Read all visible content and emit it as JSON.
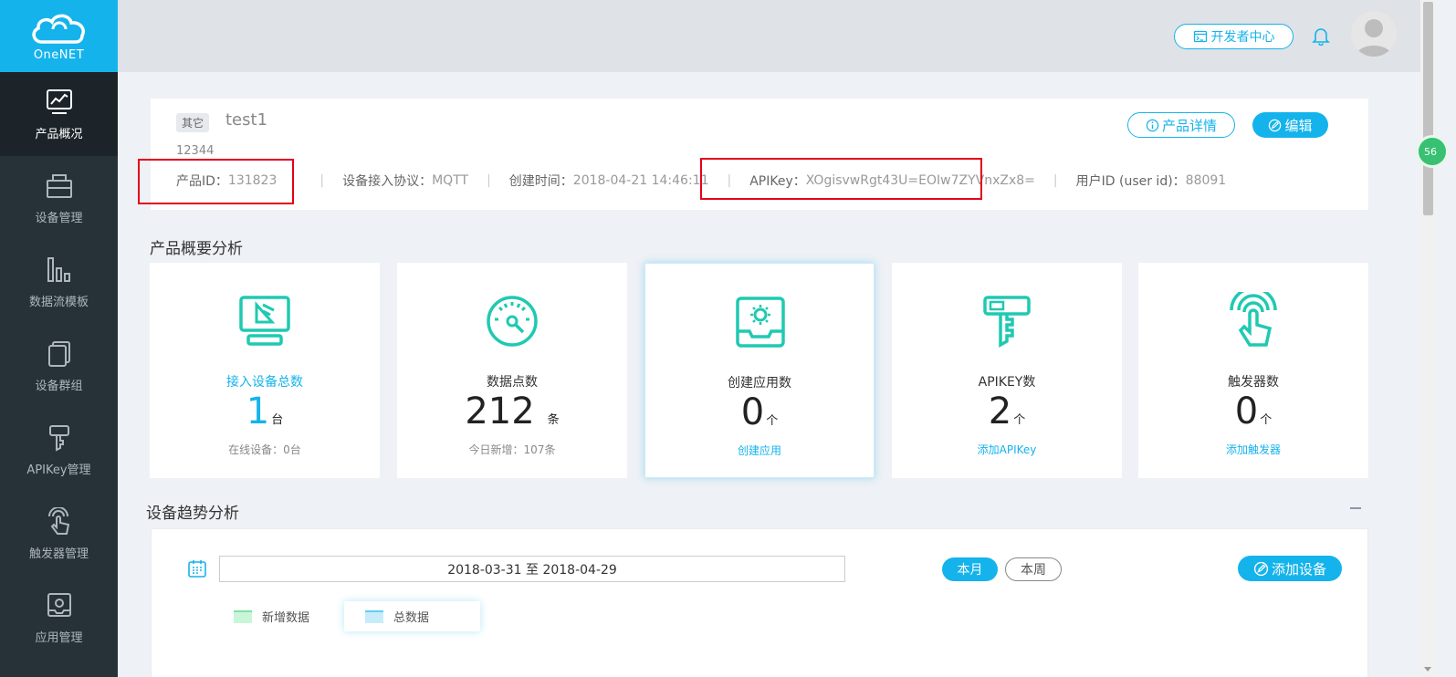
{
  "logo": {
    "text": "OneNET"
  },
  "sidebar": {
    "items": [
      {
        "label": "产品概况",
        "icon": "chart-monitor-icon",
        "active": true
      },
      {
        "label": "设备管理",
        "icon": "device-box-icon"
      },
      {
        "label": "数据流模板",
        "icon": "bar-chart-icon"
      },
      {
        "label": "设备群组",
        "icon": "device-group-icon"
      },
      {
        "label": "APIKey管理",
        "icon": "key-icon"
      },
      {
        "label": "触发器管理",
        "icon": "touch-hand-icon"
      },
      {
        "label": "应用管理",
        "icon": "app-gear-icon"
      }
    ]
  },
  "topbar": {
    "dev_center_label": "开发者中心",
    "icons": [
      "terminal-icon",
      "bell-icon",
      "avatar-icon"
    ]
  },
  "float_badge": "56",
  "product": {
    "tag": "其它",
    "name": "test1",
    "desc": "12344",
    "id_label": "产品ID：",
    "id_value": "131823",
    "protocol_label": "设备接入协议：",
    "protocol_value": "MQTT",
    "created_label": "创建时间：",
    "created_value": "2018-04-21 14:46:11",
    "apikey_label": "APIKey：",
    "apikey_value": "XOgisvwRgt43U=EOIw7ZYVnxZx8=",
    "userid_label": "用户ID (user id)：",
    "userid_value": "88091",
    "detail_btn": "产品详情",
    "edit_btn": "编辑",
    "sep": "|"
  },
  "overview": {
    "title": "产品概要分析",
    "cards": [
      {
        "label": "接入设备总数",
        "value": "1",
        "unit": "台",
        "sub": "在线设备：0台",
        "icon": "device-access-icon"
      },
      {
        "label": "数据点数",
        "value": "212",
        "unit": "条",
        "sub": "今日新增：107条",
        "icon": "gauge-icon"
      },
      {
        "label": "创建应用数",
        "value": "0",
        "unit": "个",
        "sub": "创建应用",
        "icon": "app-create-icon"
      },
      {
        "label": "APIKEY数",
        "value": "2",
        "unit": "个",
        "sub": "添加APIKey",
        "icon": "apikey-icon"
      },
      {
        "label": "触发器数",
        "value": "0",
        "unit": "个",
        "sub": "添加触发器",
        "icon": "trigger-hand-icon"
      }
    ]
  },
  "trend": {
    "title": "设备趋势分析",
    "date_range": "2018-03-31 至 2018-04-29",
    "month_btn": "本月",
    "week_btn": "本周",
    "add_device_btn": "添加设备",
    "legend": {
      "new": "新增数据",
      "total": "总数据"
    }
  },
  "colors": {
    "accent": "#15b3ec",
    "sidebar": "#263238",
    "teal_icon": "#1fc9b2",
    "highlight": "#e4001a"
  }
}
